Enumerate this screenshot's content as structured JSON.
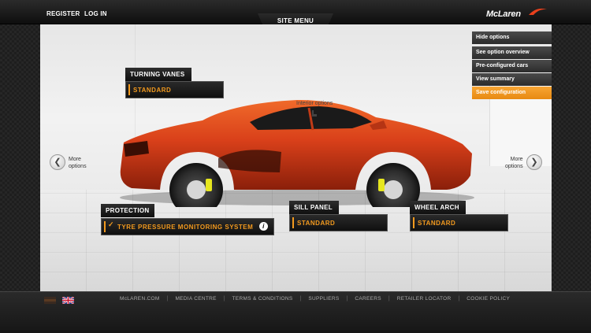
{
  "header": {
    "register": "REGISTER",
    "login": "LOG IN",
    "site_menu": "SITE MENU",
    "logo": "McLaren"
  },
  "stage": {
    "interior_options": "Interior options",
    "more_options_left": [
      "More",
      "options"
    ],
    "more_options_right": [
      "More",
      "options"
    ]
  },
  "options": {
    "turning_vanes": {
      "label": "TURNING VANES",
      "value": "STANDARD"
    },
    "protection": {
      "label": "PROTECTION",
      "value": "TYRE PRESSURE MONITORING SYSTEM"
    },
    "sill_panel": {
      "label": "SILL PANEL",
      "value": "STANDARD"
    },
    "wheel_arch": {
      "label": "WHEEL ARCH",
      "value": "STANDARD"
    }
  },
  "menu": {
    "items": [
      "Hide options",
      "See option overview",
      "Pre-configured cars",
      "View summary",
      "Save configuration"
    ],
    "active_index": 4
  },
  "footer": {
    "links": [
      "McLAREN.COM",
      "MEDIA CENTRE",
      "TERMS & CONDITIONS",
      "SUPPLIERS",
      "CAREERS",
      "RETAILER LOCATOR",
      "COOKIE POLICY"
    ]
  },
  "colors": {
    "accent": "#f39a1e",
    "car_body": "#d9401a",
    "caliper": "#e6e61e"
  }
}
